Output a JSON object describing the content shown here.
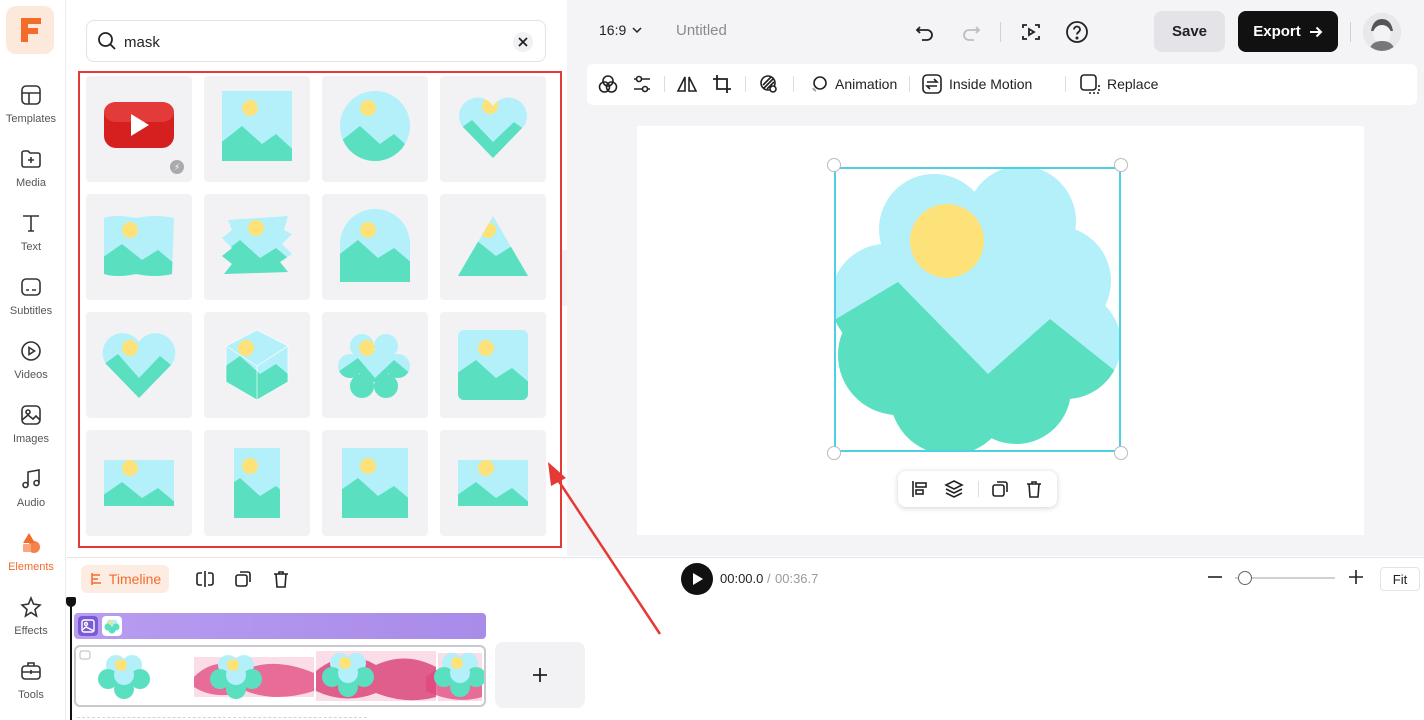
{
  "sidebar": {
    "items": [
      {
        "label": "Templates",
        "icon": "templates-icon"
      },
      {
        "label": "Media",
        "icon": "media-icon"
      },
      {
        "label": "Text",
        "icon": "text-icon"
      },
      {
        "label": "Subtitles",
        "icon": "subtitles-icon"
      },
      {
        "label": "Videos",
        "icon": "videos-icon"
      },
      {
        "label": "Images",
        "icon": "images-icon"
      },
      {
        "label": "Audio",
        "icon": "audio-icon"
      },
      {
        "label": "Elements",
        "icon": "elements-icon",
        "active": true
      },
      {
        "label": "Effects",
        "icon": "effects-icon"
      },
      {
        "label": "Tools",
        "icon": "tools-icon"
      }
    ]
  },
  "search": {
    "value": "mask",
    "placeholder": ""
  },
  "elements_grid": [
    "youtube-frame",
    "square-mask",
    "circle-mask",
    "heart-mask",
    "brush-rect-mask",
    "brush-stroke-mask",
    "arch-mask",
    "triangle-mask",
    "heart-mask-2",
    "hexagon-mask",
    "flower-mask",
    "rounded-square-mask",
    "wide-rect-mask",
    "tall-rect-mask",
    "square-mask-2",
    "wide-rect-mask-2"
  ],
  "header": {
    "ratio": "16:9",
    "title": "Untitled",
    "save_label": "Save",
    "export_label": "Export"
  },
  "toolbar": {
    "animation_label": "Animation",
    "inside_motion_label": "Inside Motion",
    "replace_label": "Replace"
  },
  "timeline": {
    "tab_label": "Timeline",
    "current_time": "00:00.0",
    "separator": "/",
    "total_time": "00:36.7",
    "fit_label": "Fit",
    "zoom_level": 0.03
  },
  "colors": {
    "accent": "#f36c2c",
    "mask_sky": "#b3f0fa",
    "mask_ground": "#5ae0c0",
    "mask_sun": "#fde27a",
    "selection": "#4dd0e1",
    "highlight_box": "#e53935"
  }
}
